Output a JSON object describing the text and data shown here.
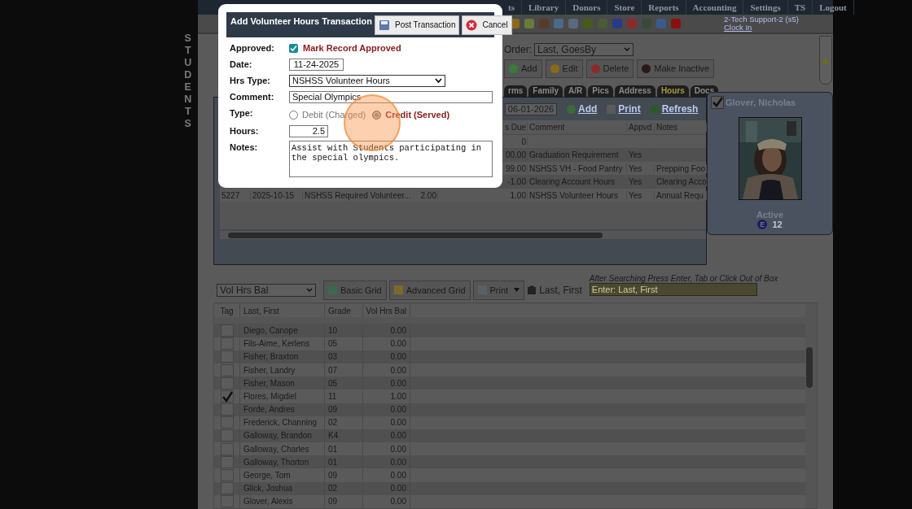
{
  "side_label": "STUDENTS",
  "menu": [
    {
      "label": "ts"
    },
    {
      "label": "Library"
    },
    {
      "label": "Donors"
    },
    {
      "label": "Store"
    },
    {
      "label": "Reports"
    },
    {
      "label": "Accounting"
    },
    {
      "label": "Settings"
    },
    {
      "label": "TS"
    },
    {
      "label": "Logout"
    }
  ],
  "user": {
    "name": "2-Tech Support-2 (s5)",
    "link": "Clock In"
  },
  "order": {
    "label": "Order:",
    "value": "Last, GoesBy"
  },
  "actions": [
    {
      "label": "Add",
      "kind": "add"
    },
    {
      "label": "Edit",
      "kind": "edit"
    },
    {
      "label": "Delete",
      "kind": "delete"
    },
    {
      "label": "Make Inactive",
      "kind": "inactive"
    }
  ],
  "tabs": [
    {
      "label": "rms",
      "selected": false
    },
    {
      "label": "Family",
      "selected": false
    },
    {
      "label": "A/R",
      "selected": false
    },
    {
      "label": "Pics",
      "selected": false
    },
    {
      "label": "Address",
      "selected": false
    },
    {
      "label": "Hours",
      "selected": true
    },
    {
      "label": "Docs",
      "selected": false
    }
  ],
  "hours_panel": {
    "date": "06-01-2026",
    "links": [
      {
        "label": "Add",
        "kind": "add"
      },
      {
        "label": "Print",
        "kind": "print"
      },
      {
        "label": "Refresh",
        "kind": "refresh"
      }
    ],
    "columns": [
      "",
      "",
      "",
      "",
      "",
      "s Due",
      "Comment",
      "Appvd",
      "Notes"
    ],
    "rows": [
      {
        "cells": [
          "",
          "",
          "",
          "",
          "",
          "0",
          "",
          "",
          ""
        ]
      },
      {
        "cells": [
          "",
          "",
          "",
          "",
          "",
          "00.00",
          "Graduation Requirement",
          "Yes",
          ""
        ]
      },
      {
        "cells": [
          "",
          "",
          "",
          "",
          "",
          "99.00",
          "NSHSS VH - Food Pantry",
          "Yes",
          "Prepping Foo"
        ]
      },
      {
        "cells": [
          "",
          "",
          "",
          "",
          "",
          "-1.00",
          "Clearing Account Hours",
          "Yes",
          "Clearing Acco"
        ]
      },
      {
        "cells": [
          "5227",
          "2025-10-15",
          "NSHSS Required Volunteer...",
          "2.00",
          "",
          "1.00",
          "NSHSS Volunteer Hours",
          "Yes",
          "Annual Requ"
        ]
      }
    ]
  },
  "card": {
    "checked": true,
    "name": "Glover, Nicholas",
    "status": "Active",
    "badge": "E",
    "grade": "12"
  },
  "list_toolbar": {
    "view": "Vol Hrs Bal",
    "buttons": [
      {
        "label": "Basic Grid",
        "kind": "grid"
      },
      {
        "label": "Advanced Grid",
        "kind": "advanced"
      },
      {
        "label": "Print",
        "kind": "print"
      }
    ],
    "sort_label": "Last, First",
    "hint": "After Searching Press Enter, Tab or Click Out of Box",
    "search": {
      "placeholder": "Enter: Last, First"
    }
  },
  "grid": {
    "columns": [
      "Tag",
      "Last, First",
      "Grade",
      "Vol Hrs Bal"
    ],
    "rows": [
      {
        "name": "Diego, Canope",
        "grade": "10",
        "balance": "0.00",
        "checked": false
      },
      {
        "name": "Fils-Aime, Kerlens",
        "grade": "05",
        "balance": "0.00",
        "checked": false
      },
      {
        "name": "Fisher, Braxton",
        "grade": "03",
        "balance": "0.00",
        "checked": false
      },
      {
        "name": "Fisher, Landry",
        "grade": "07",
        "balance": "0.00",
        "checked": false
      },
      {
        "name": "Fisher, Mason",
        "grade": "05",
        "balance": "0.00",
        "checked": false
      },
      {
        "name": "Flores, Migdiel",
        "grade": "11",
        "balance": "1.00",
        "checked": true
      },
      {
        "name": "Forde, Andres",
        "grade": "09",
        "balance": "0.00",
        "checked": false
      },
      {
        "name": "Frederick, Channing",
        "grade": "02",
        "balance": "0.00",
        "checked": false
      },
      {
        "name": "Galloway, Brandon",
        "grade": "K4",
        "balance": "0.00",
        "checked": false
      },
      {
        "name": "Galloway, Charles",
        "grade": "01",
        "balance": "0.00",
        "checked": false
      },
      {
        "name": "Galloway, Thorton",
        "grade": "01",
        "balance": "0.00",
        "checked": false
      },
      {
        "name": "George, Tom",
        "grade": "09",
        "balance": "0.00",
        "checked": false
      },
      {
        "name": "Glick, Joshua",
        "grade": "02",
        "balance": "0.00",
        "checked": false
      },
      {
        "name": "Glover, Alexis",
        "grade": "09",
        "balance": "0.00",
        "checked": false
      }
    ]
  },
  "dialog": {
    "title": "Add Volunteer Hours Transaction",
    "buttons": [
      {
        "label": "Post Transaction",
        "kind": "save"
      },
      {
        "label": "Cancel",
        "kind": "cancel"
      }
    ],
    "approved": {
      "label": "Approved:",
      "checked": true,
      "text": "Mark Record Approved"
    },
    "date": {
      "label": "Date:",
      "value": "11-24-2025"
    },
    "hrs_type": {
      "label": "Hrs Type:",
      "value": "NSHSS Volunteer Hours"
    },
    "comment": {
      "label": "Comment:",
      "value": "Special Olympics"
    },
    "type": {
      "label": "Type:",
      "options": [
        {
          "label": "Debit (Charged)",
          "selected": false
        },
        {
          "label": "Credit (Served)",
          "selected": true
        }
      ]
    },
    "hours": {
      "label": "Hours:",
      "value": "2.5"
    },
    "notes": {
      "label": "Notes:",
      "value": "Assist with Students participating in the special olympics."
    }
  }
}
